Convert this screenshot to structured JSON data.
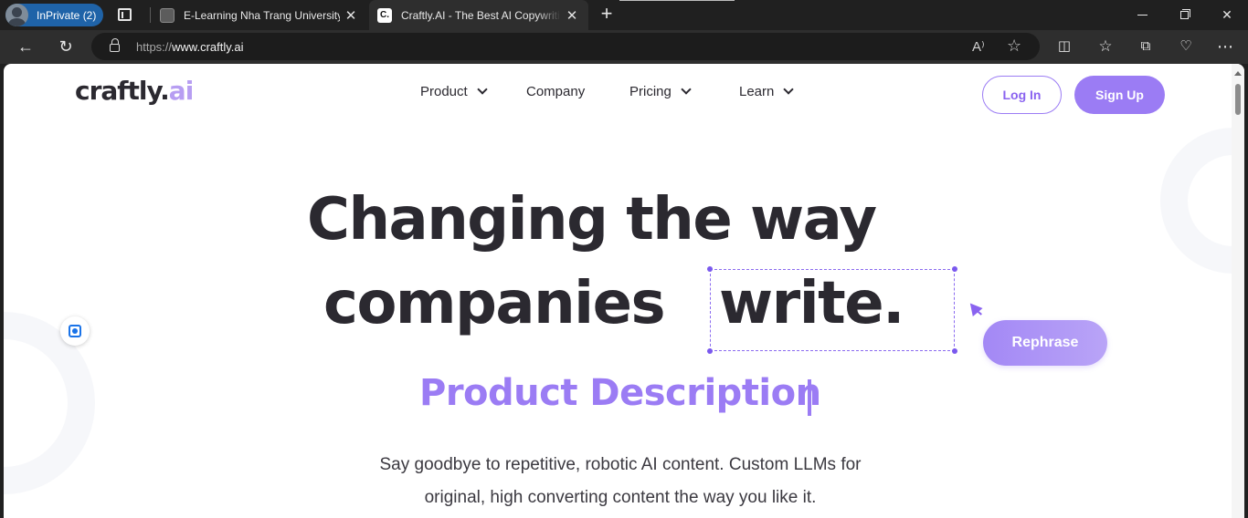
{
  "browser": {
    "profile_label": "InPrivate (2)",
    "tabs": [
      {
        "title": "E-Learning Nha Trang University",
        "close": "✕"
      },
      {
        "title": "Craftly.AI - The Best AI Copywriting",
        "favicon_text": "C.",
        "close": "✕"
      }
    ],
    "new_tab": "+",
    "window": {
      "minimize": "",
      "restore": "",
      "close": "✕"
    },
    "nav": {
      "back": "←",
      "reload": "↻"
    },
    "address": {
      "protocol": "https://",
      "host": "www.craftly.ai"
    },
    "address_icons": {
      "read_aloud": "A⁾",
      "favorite": "☆"
    },
    "toolbar_icons": {
      "split": "◫",
      "favorites": "☆",
      "collections": "⧉",
      "health": "♡",
      "more": "⋯"
    }
  },
  "site": {
    "logo": {
      "main": "craftly",
      "dot": ".",
      "ai": "ai"
    },
    "nav": [
      {
        "label": "Product",
        "has_dropdown": true
      },
      {
        "label": "Company",
        "has_dropdown": false
      },
      {
        "label": "Pricing",
        "has_dropdown": true
      },
      {
        "label": "Learn",
        "has_dropdown": true
      }
    ],
    "login_label": "Log In",
    "signup_label": "Sign Up",
    "hero": {
      "line1": "Changing the way",
      "line2_part1": "companies",
      "line2_part2": "write."
    },
    "rephrase_label": "Rephrase",
    "subtitle": "Product Description",
    "description_line1": "Say goodbye to repetitive, robotic AI content. Custom LLMs for",
    "description_line2": "original, high converting content the way you like it."
  },
  "colors": {
    "accent": "#9b7cf4",
    "text_dark": "#2b2930",
    "browser_bg": "#202020",
    "inprivate_badge": "#1f63a8"
  }
}
